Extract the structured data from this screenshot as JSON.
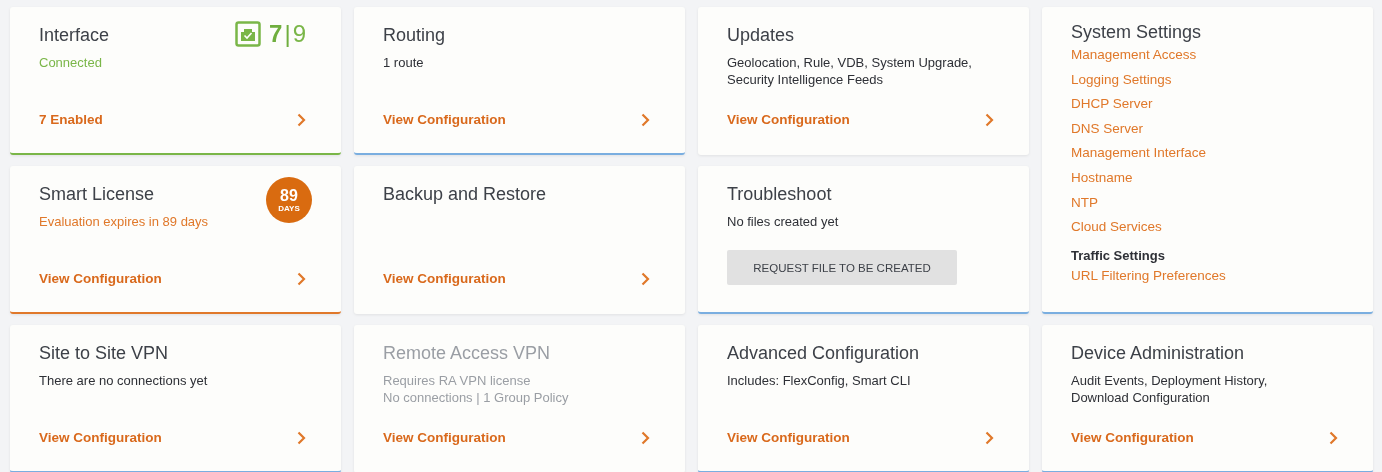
{
  "columns": [
    {
      "cards": [
        {
          "title": "Interface",
          "disabled": false,
          "color": "#7ab648",
          "lines": [
            {
              "text": "Connected",
              "kind": "success"
            }
          ],
          "counter": {
            "enabled": "7",
            "separator": "|",
            "total": "9"
          },
          "link": "7 Enabled"
        },
        {
          "title": "Smart License",
          "disabled": false,
          "color": "#e0782a",
          "lines": [
            {
              "text": "Evaluation expires in 89 days",
              "kind": "warning"
            }
          ],
          "days": {
            "value": "89",
            "unit": "DAYS"
          },
          "link": "View Configuration"
        },
        {
          "title": "Site to Site VPN",
          "disabled": false,
          "color": "#7aaee0",
          "lines": [
            {
              "text": "There are no connections yet",
              "kind": "normal"
            }
          ],
          "link": "View Configuration"
        }
      ]
    },
    {
      "cards": [
        {
          "title": "Routing",
          "disabled": false,
          "color": "#7aaee0",
          "lines": [
            {
              "text": "1 route",
              "kind": "normal"
            }
          ],
          "link": "View Configuration"
        },
        {
          "title": "Backup and Restore",
          "disabled": false,
          "link": "View Configuration"
        },
        {
          "title": "Remote Access VPN",
          "disabled": true,
          "lines": [
            {
              "text": "Requires RA VPN license",
              "kind": "normal"
            },
            {
              "text": "No connections | 1 Group Policy",
              "kind": "normal"
            }
          ],
          "link": "View Configuration"
        }
      ]
    },
    {
      "cards": [
        {
          "title": "Updates",
          "disabled": false,
          "lines": [
            {
              "text": "Geolocation, Rule, VDB, System Upgrade, Security Intelligence Feeds",
              "kind": "normal"
            }
          ],
          "link": "View Configuration"
        },
        {
          "title": "Troubleshoot",
          "disabled": false,
          "color": "#7aaee0",
          "lines": [
            {
              "text": "No files created yet",
              "kind": "normal"
            }
          ],
          "button": "REQUEST FILE TO BE CREATED"
        },
        {
          "title": "Advanced Configuration",
          "disabled": false,
          "color": "#7aaee0",
          "lines": [
            {
              "text": "Includes: FlexConfig, Smart CLI",
              "kind": "normal"
            }
          ],
          "link": "View Configuration"
        }
      ]
    },
    {
      "cards": [
        {
          "title": "System Settings",
          "disabled": false,
          "color": "#7aaee0",
          "sections": [
            {
              "links": [
                "Management Access",
                "Logging Settings",
                "DHCP Server",
                "DNS Server",
                "Management Interface",
                "Hostname",
                "NTP",
                "Cloud Services"
              ]
            },
            {
              "heading": "Traffic Settings",
              "links": [
                "URL Filtering Preferences"
              ]
            }
          ]
        },
        {
          "title": "Device Administration",
          "disabled": false,
          "color": "#7aaee0",
          "lines": [
            {
              "text": "Audit Events, Deployment History, Download Configuration",
              "kind": "normal"
            }
          ],
          "link": "View Configuration"
        }
      ]
    }
  ]
}
